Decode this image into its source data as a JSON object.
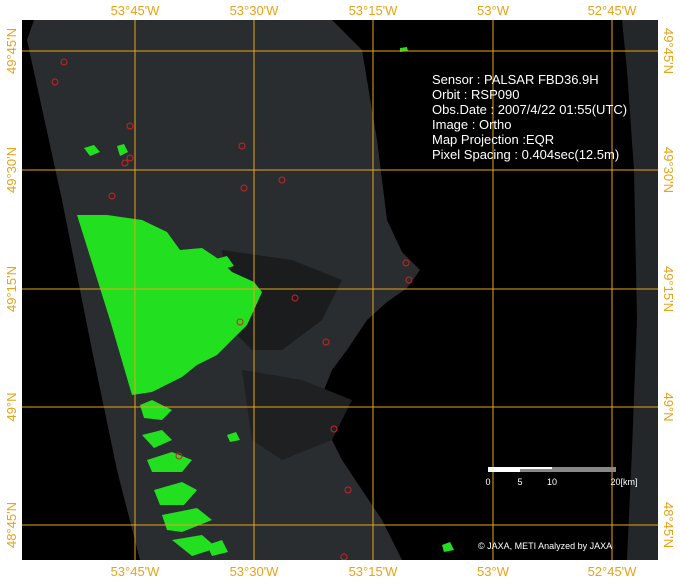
{
  "map": {
    "longitude_labels": [
      "53°45'W",
      "53°30'W",
      "53°15'W",
      "53°W",
      "52°45'W"
    ],
    "latitude_labels": [
      "49°45'N",
      "49°30'N",
      "49°15'N",
      "49°N",
      "48°45'N"
    ],
    "colors": {
      "frame_background": "#ffffff",
      "image_background": "#000000",
      "land_sar": "#2a2d30",
      "dark_water": "#101214",
      "flood_highlight": "#22e01f",
      "grid_line": "#e8a317",
      "label": "#e8a317",
      "marker": "#cc2222",
      "text": "#ffffff"
    }
  },
  "info": {
    "sensor": "Sensor : PALSAR FBD36.9H",
    "orbit": "Orbit : RSP090",
    "obs_date": "Obs.Date : 2007/4/22 01:55(UTC)",
    "image": "Image : Ortho",
    "map_projection": "Map Projection :EQR",
    "pixel_spacing": "Pixel Spacing : 0.404sec(12.5m)"
  },
  "scale": {
    "ticks": [
      "0",
      "5",
      "10",
      "20[km]"
    ],
    "segment_colors": [
      "#ffffff",
      "#888888",
      "#ffffff",
      "#888888"
    ]
  },
  "copyright": "© JAXA, METI  Analyzed by JAXA"
}
